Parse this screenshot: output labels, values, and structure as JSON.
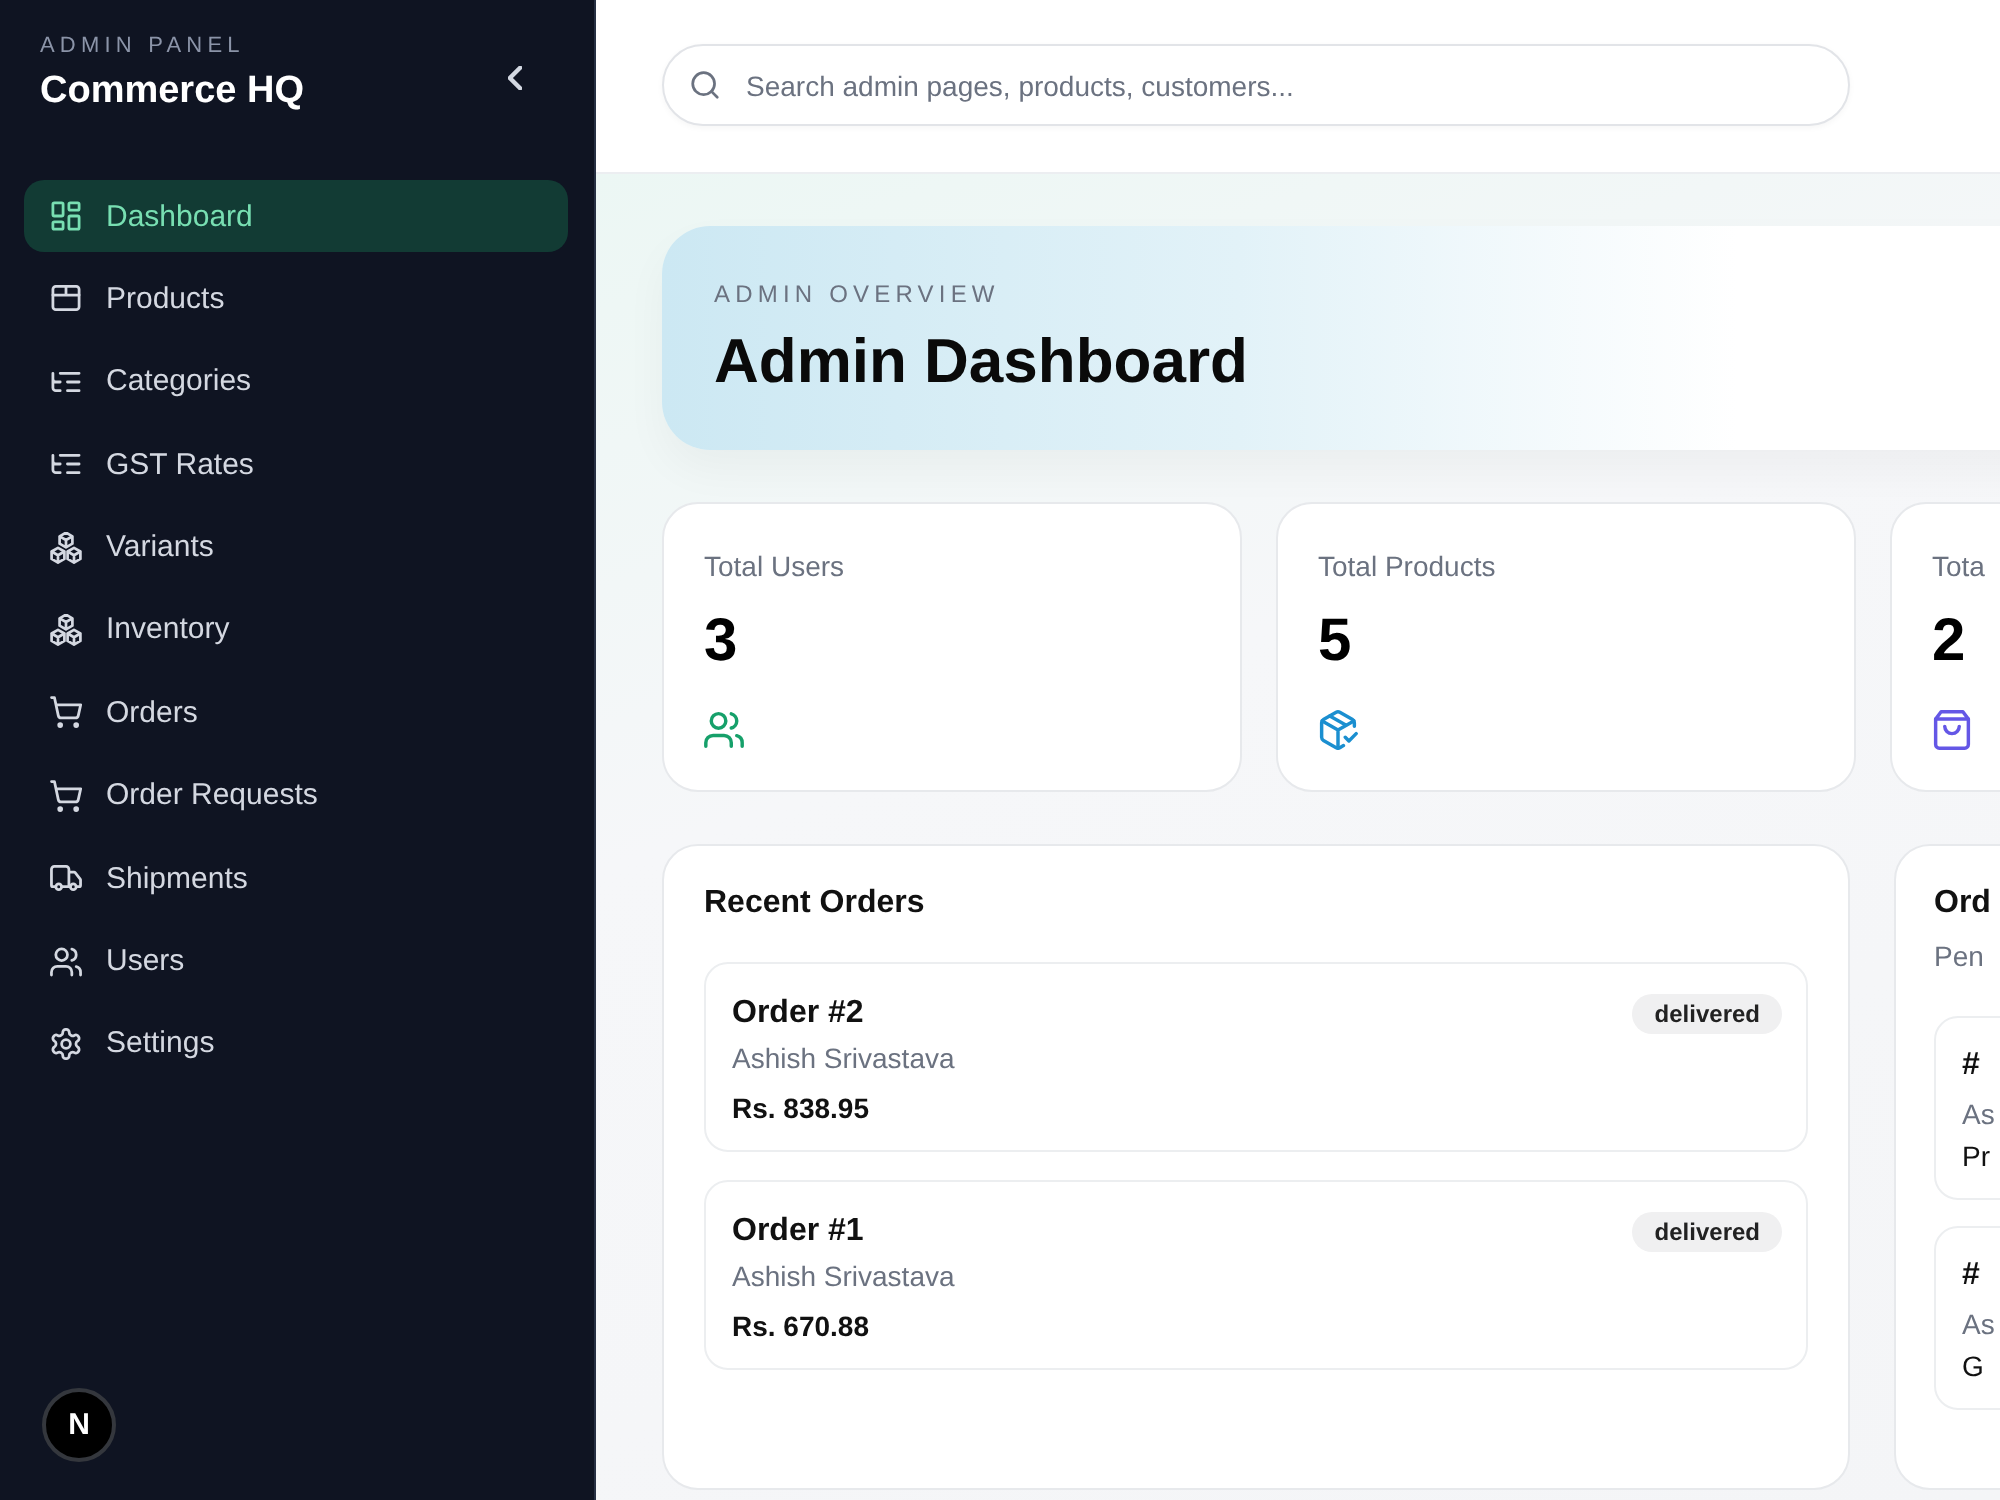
{
  "sidebar": {
    "eyebrow": "ADMIN PANEL",
    "title": "Commerce HQ",
    "items": [
      {
        "label": "Dashboard",
        "kind": "grid",
        "selected": true
      },
      {
        "label": "Products",
        "kind": "box",
        "selected": false
      },
      {
        "label": "Categories",
        "kind": "tree",
        "selected": false
      },
      {
        "label": "GST Rates",
        "kind": "tree",
        "selected": false
      },
      {
        "label": "Variants",
        "kind": "cubes",
        "selected": false
      },
      {
        "label": "Inventory",
        "kind": "cubes",
        "selected": false
      },
      {
        "label": "Orders",
        "kind": "cart",
        "selected": false
      },
      {
        "label": "Order Requests",
        "kind": "cart",
        "selected": false
      },
      {
        "label": "Shipments",
        "kind": "truck",
        "selected": false
      },
      {
        "label": "Users",
        "kind": "users",
        "selected": false
      },
      {
        "label": "Settings",
        "kind": "gear",
        "selected": false
      }
    ],
    "dev_button": {
      "label": "N"
    }
  },
  "search": {
    "placeholder": "Search admin pages, products, customers..."
  },
  "hero": {
    "eyebrow": "ADMIN OVERVIEW",
    "title": "Admin Dashboard"
  },
  "stats": [
    {
      "label": "Total Users",
      "value": "3",
      "kind": "users"
    },
    {
      "label": "Total Products",
      "value": "5",
      "kind": "package"
    },
    {
      "label": "Tota",
      "value": "2",
      "kind": "bag"
    }
  ],
  "recent_orders": {
    "title": "Recent Orders",
    "orders": [
      {
        "title": "Order #2",
        "customer": "Ashish Srivastava",
        "total": "Rs. 838.95",
        "status": "delivered"
      },
      {
        "title": "Order #1",
        "customer": "Ashish Srivastava",
        "total": "Rs. 670.88",
        "status": "delivered"
      }
    ]
  },
  "panel_2": {
    "title": "Ord",
    "subtitle": "Pen",
    "items": [
      {
        "line_1": "#",
        "line_2": "As",
        "line_3": "Pr"
      },
      {
        "line_1": "#",
        "line_2": "As",
        "line_3": "G"
      }
    ]
  }
}
